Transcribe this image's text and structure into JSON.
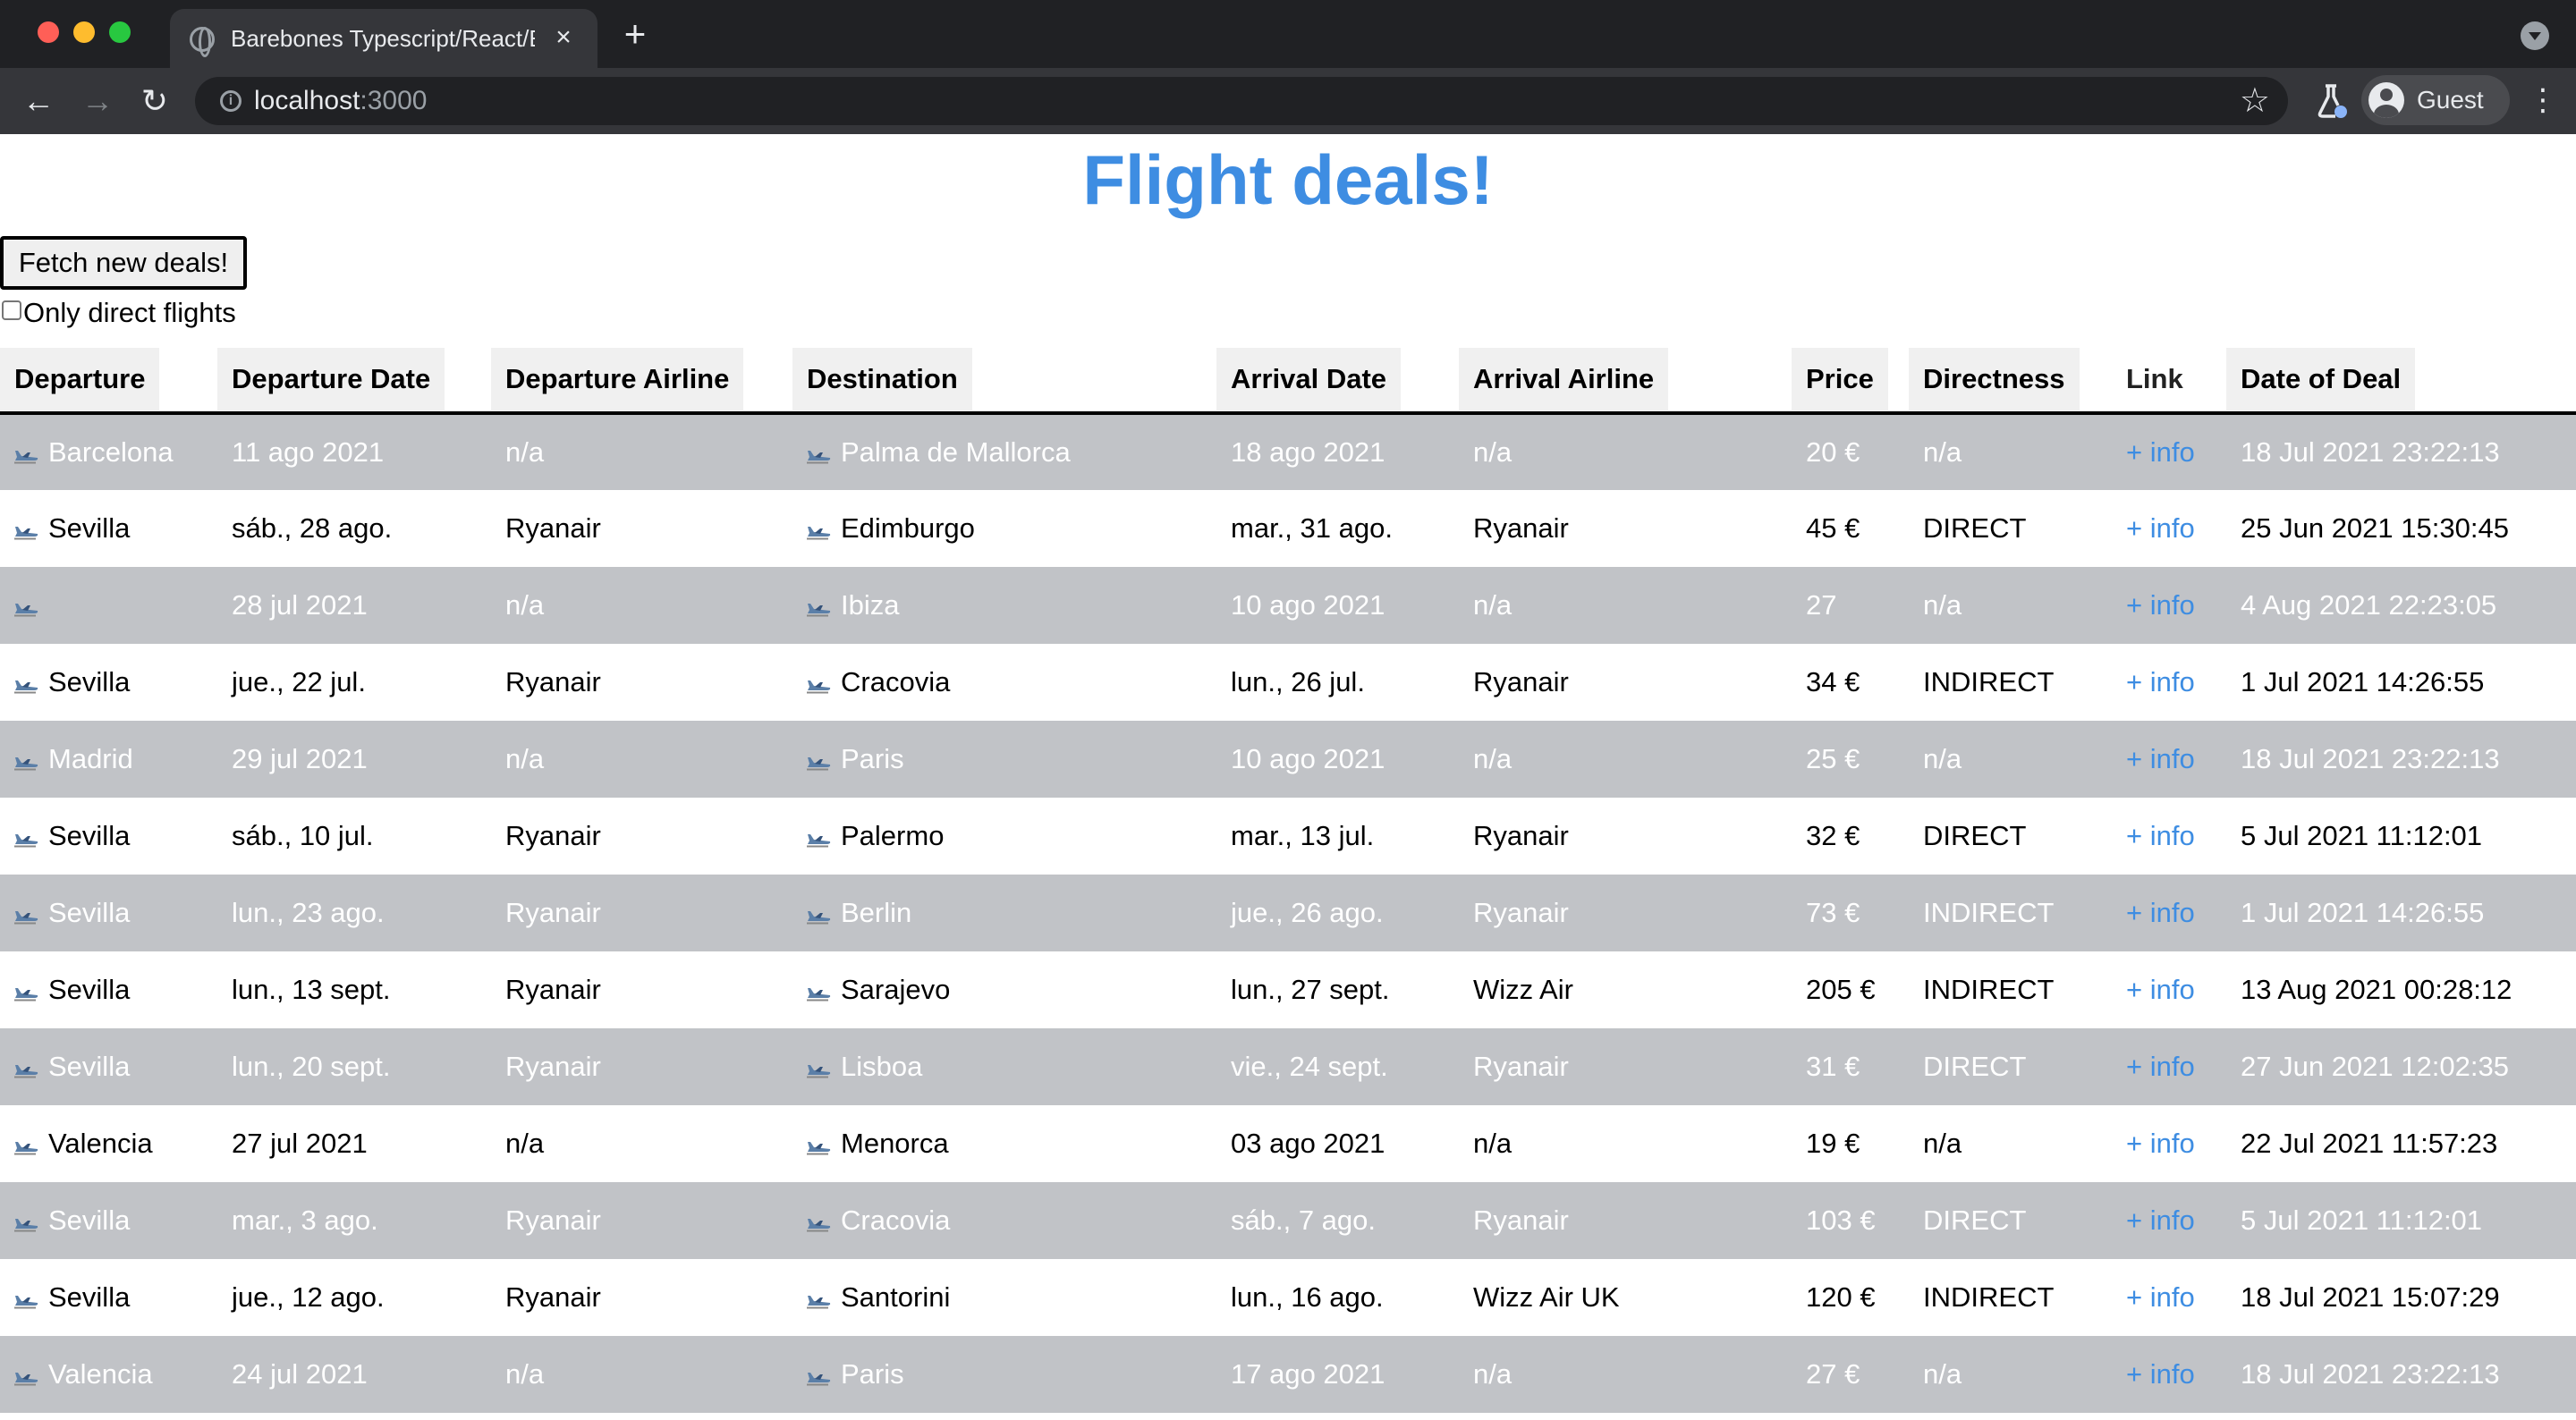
{
  "browser": {
    "tab_title": "Barebones Typescript/React/Express",
    "url_host": "localhost",
    "url_port": ":3000",
    "profile_label": "Guest",
    "icons": {
      "tab": "globe-icon",
      "back": "back-arrow-icon",
      "forward": "forward-arrow-icon",
      "reload": "reload-icon",
      "site_info": "info-icon",
      "bookmark": "star-icon",
      "labs": "labs-flask-icon",
      "menu": "kebab-menu-icon"
    }
  },
  "page": {
    "title": "Flight deals!",
    "fetch_button": "Fetch new deals!",
    "direct_checkbox_label": "Only direct flights",
    "direct_checkbox_checked": false,
    "accent_color": "#3e8de2",
    "stripe_color": "#c1c3c7"
  },
  "table": {
    "headers": {
      "departure": "Departure",
      "departure_date": "Departure Date",
      "departure_airline": "Departure Airline",
      "destination": "Destination",
      "arrival_date": "Arrival Date",
      "arrival_airline": "Arrival Airline",
      "price": "Price",
      "directness": "Directness",
      "link": "Link",
      "date_of_deal": "Date of Deal"
    },
    "rows": [
      {
        "departure": "Barcelona",
        "departure_date": "11 ago 2021",
        "departure_airline": "n/a",
        "destination": "Palma de Mallorca",
        "arrival_date": "18 ago 2021",
        "arrival_airline": "n/a",
        "price": "20 €",
        "directness": "n/a",
        "link": "+ info",
        "date_of_deal": "18 Jul 2021 23:22:13"
      },
      {
        "departure": "Sevilla",
        "departure_date": "sáb., 28 ago.",
        "departure_airline": "Ryanair",
        "destination": "Edimburgo",
        "arrival_date": "mar., 31 ago.",
        "arrival_airline": "Ryanair",
        "price": "45 €",
        "directness": "DIRECT",
        "link": "+ info",
        "date_of_deal": "25 Jun 2021 15:30:45"
      },
      {
        "departure": "",
        "departure_date": "28 jul 2021",
        "departure_airline": "n/a",
        "destination": "Ibiza",
        "arrival_date": "10 ago 2021",
        "arrival_airline": "n/a",
        "price": "27",
        "directness": "n/a",
        "link": "+ info",
        "date_of_deal": "4 Aug 2021 22:23:05"
      },
      {
        "departure": "Sevilla",
        "departure_date": "jue., 22 jul.",
        "departure_airline": "Ryanair",
        "destination": "Cracovia",
        "arrival_date": "lun., 26 jul.",
        "arrival_airline": "Ryanair",
        "price": "34 €",
        "directness": "INDIRECT",
        "link": "+ info",
        "date_of_deal": "1 Jul 2021 14:26:55"
      },
      {
        "departure": "Madrid",
        "departure_date": "29 jul 2021",
        "departure_airline": "n/a",
        "destination": "Paris",
        "arrival_date": "10 ago 2021",
        "arrival_airline": "n/a",
        "price": "25 €",
        "directness": "n/a",
        "link": "+ info",
        "date_of_deal": "18 Jul 2021 23:22:13"
      },
      {
        "departure": "Sevilla",
        "departure_date": "sáb., 10 jul.",
        "departure_airline": "Ryanair",
        "destination": "Palermo",
        "arrival_date": "mar., 13 jul.",
        "arrival_airline": "Ryanair",
        "price": "32 €",
        "directness": "DIRECT",
        "link": "+ info",
        "date_of_deal": "5 Jul 2021 11:12:01"
      },
      {
        "departure": "Sevilla",
        "departure_date": "lun., 23 ago.",
        "departure_airline": "Ryanair",
        "destination": "Berlin",
        "arrival_date": "jue., 26 ago.",
        "arrival_airline": "Ryanair",
        "price": "73 €",
        "directness": "INDIRECT",
        "link": "+ info",
        "date_of_deal": "1 Jul 2021 14:26:55"
      },
      {
        "departure": "Sevilla",
        "departure_date": "lun., 13 sept.",
        "departure_airline": "Ryanair",
        "destination": "Sarajevo",
        "arrival_date": "lun., 27 sept.",
        "arrival_airline": "Wizz Air",
        "price": "205 €",
        "directness": "INDIRECT",
        "link": "+ info",
        "date_of_deal": "13 Aug 2021 00:28:12"
      },
      {
        "departure": "Sevilla",
        "departure_date": "lun., 20 sept.",
        "departure_airline": "Ryanair",
        "destination": "Lisboa",
        "arrival_date": "vie., 24 sept.",
        "arrival_airline": "Ryanair",
        "price": "31 €",
        "directness": "DIRECT",
        "link": "+ info",
        "date_of_deal": "27 Jun 2021 12:02:35"
      },
      {
        "departure": "Valencia",
        "departure_date": "27 jul 2021",
        "departure_airline": "n/a",
        "destination": "Menorca",
        "arrival_date": "03 ago 2021",
        "arrival_airline": "n/a",
        "price": "19 €",
        "directness": "n/a",
        "link": "+ info",
        "date_of_deal": "22 Jul 2021 11:57:23"
      },
      {
        "departure": "Sevilla",
        "departure_date": "mar., 3 ago.",
        "departure_airline": "Ryanair",
        "destination": "Cracovia",
        "arrival_date": "sáb., 7 ago.",
        "arrival_airline": "Ryanair",
        "price": "103 €",
        "directness": "DIRECT",
        "link": "+ info",
        "date_of_deal": "5 Jul 2021 11:12:01"
      },
      {
        "departure": "Sevilla",
        "departure_date": "jue., 12 ago.",
        "departure_airline": "Ryanair",
        "destination": "Santorini",
        "arrival_date": "lun., 16 ago.",
        "arrival_airline": "Wizz Air UK",
        "price": "120 €",
        "directness": "INDIRECT",
        "link": "+ info",
        "date_of_deal": "18 Jul 2021 15:07:29"
      },
      {
        "departure": "Valencia",
        "departure_date": "24 jul 2021",
        "departure_airline": "n/a",
        "destination": "Paris",
        "arrival_date": "17 ago 2021",
        "arrival_airline": "n/a",
        "price": "27 €",
        "directness": "n/a",
        "link": "+ info",
        "date_of_deal": "18 Jul 2021 23:22:13"
      }
    ]
  }
}
